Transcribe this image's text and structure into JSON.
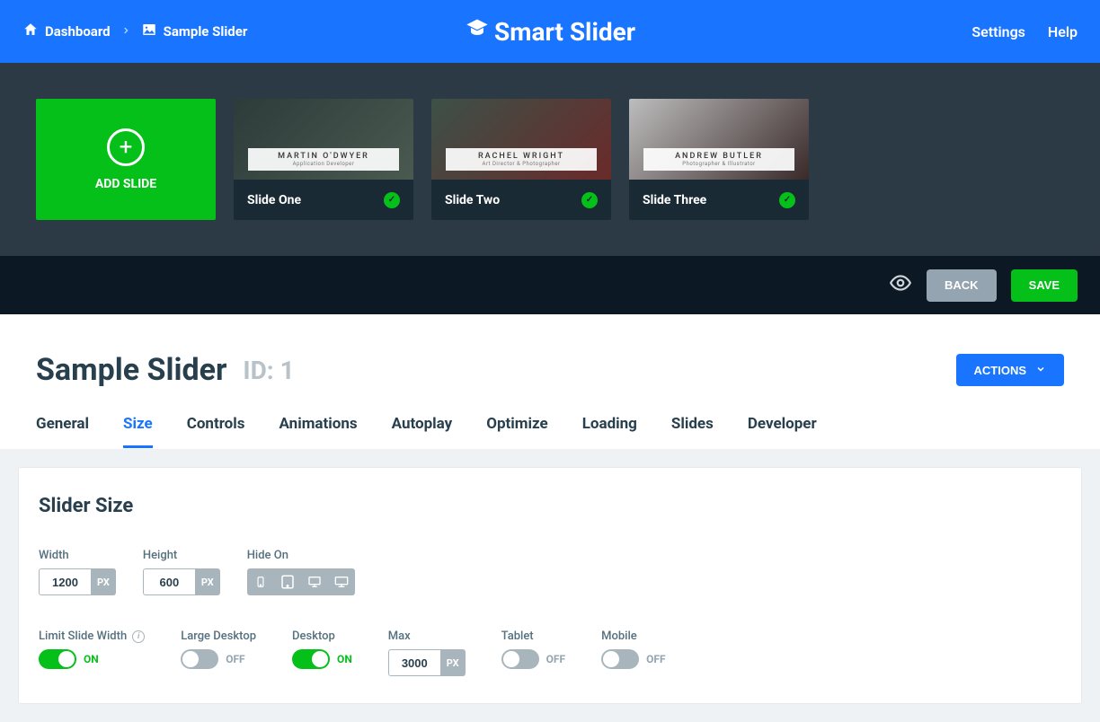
{
  "topbar": {
    "crumb_home": "Dashboard",
    "crumb_current": "Sample Slider",
    "logo_text": "Smart Slider",
    "settings": "Settings",
    "help": "Help"
  },
  "strip": {
    "add_label": "ADD SLIDE",
    "slides": [
      {
        "title": "Slide One",
        "overlay_name": "MARTIN O'DWYER",
        "overlay_sub": "Application Developer"
      },
      {
        "title": "Slide Two",
        "overlay_name": "RACHEL WRIGHT",
        "overlay_sub": "Art Director & Photographer"
      },
      {
        "title": "Slide Three",
        "overlay_name": "ANDREW BUTLER",
        "overlay_sub": "Photographer & Illustrator"
      }
    ]
  },
  "actionbar": {
    "back": "BACK",
    "save": "SAVE"
  },
  "page": {
    "title": "Sample Slider",
    "id_label": "ID: 1",
    "actions_btn": "ACTIONS",
    "tabs": [
      "General",
      "Size",
      "Controls",
      "Animations",
      "Autoplay",
      "Optimize",
      "Loading",
      "Slides",
      "Developer"
    ],
    "active_tab": "Size"
  },
  "panel": {
    "heading": "Slider Size",
    "width_label": "Width",
    "width_value": "1200",
    "height_label": "Height",
    "height_value": "600",
    "px": "PX",
    "hideon_label": "Hide On",
    "row2": {
      "limit_label": "Limit Slide Width",
      "large_desktop_label": "Large Desktop",
      "desktop_label": "Desktop",
      "max_label": "Max",
      "max_value": "3000",
      "tablet_label": "Tablet",
      "mobile_label": "Mobile",
      "on": "ON",
      "off": "OFF"
    }
  }
}
